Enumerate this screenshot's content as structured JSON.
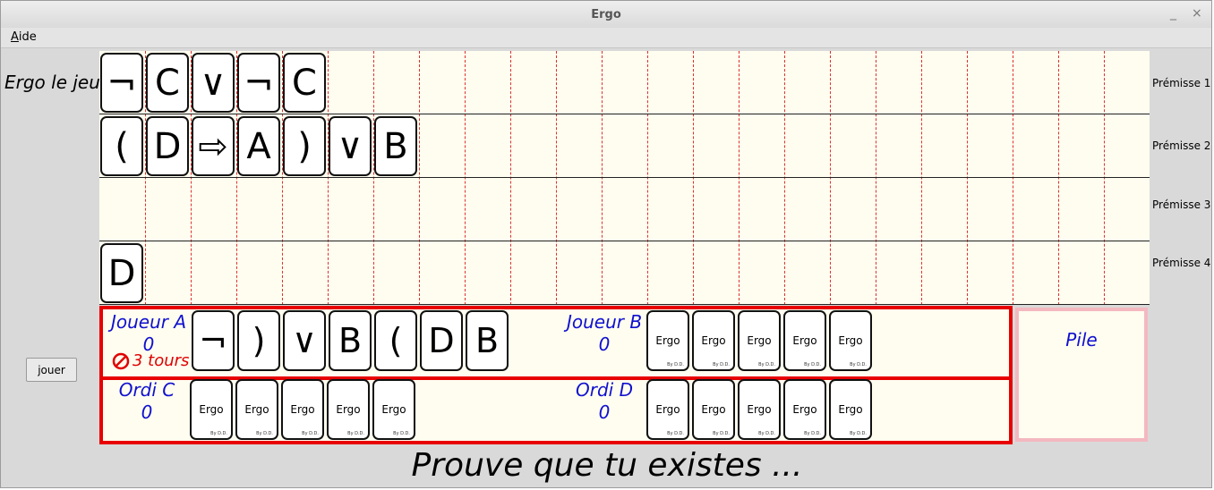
{
  "window": {
    "title": "Ergo",
    "minimize": "_",
    "close": "×"
  },
  "menu": {
    "aide": "Aide"
  },
  "game_title": "Ergo le jeu",
  "premises": [
    {
      "label": "Prémisse 1",
      "cards": [
        "¬",
        "C",
        "∨",
        "¬",
        "C"
      ]
    },
    {
      "label": "Prémisse 2",
      "cards": [
        "(",
        "D",
        "⇨",
        "A",
        ")",
        "∨",
        "B"
      ]
    },
    {
      "label": "Prémisse 3",
      "cards": []
    },
    {
      "label": "Prémisse 4",
      "cards": [
        "D"
      ]
    }
  ],
  "players": {
    "a": {
      "name": "Joueur A",
      "score": "0",
      "tours": "3 tours",
      "cards": [
        "¬",
        ")",
        "∨",
        "B",
        "(",
        "D",
        "B"
      ]
    },
    "b": {
      "name": "Joueur B",
      "score": "0",
      "cards": [
        "Ergo",
        "Ergo",
        "Ergo",
        "Ergo",
        "Ergo"
      ]
    },
    "c": {
      "name": "Ordi C",
      "score": "0",
      "cards": [
        "Ergo",
        "Ergo",
        "Ergo",
        "Ergo",
        "Ergo"
      ]
    },
    "d": {
      "name": "Ordi D",
      "score": "0",
      "cards": [
        "Ergo",
        "Ergo",
        "Ergo",
        "Ergo",
        "Ergo"
      ]
    }
  },
  "card_back_footer": "By D.D.",
  "pile_label": "Pile",
  "jouer_label": "jouer",
  "message": "Prouve que tu existes ..."
}
